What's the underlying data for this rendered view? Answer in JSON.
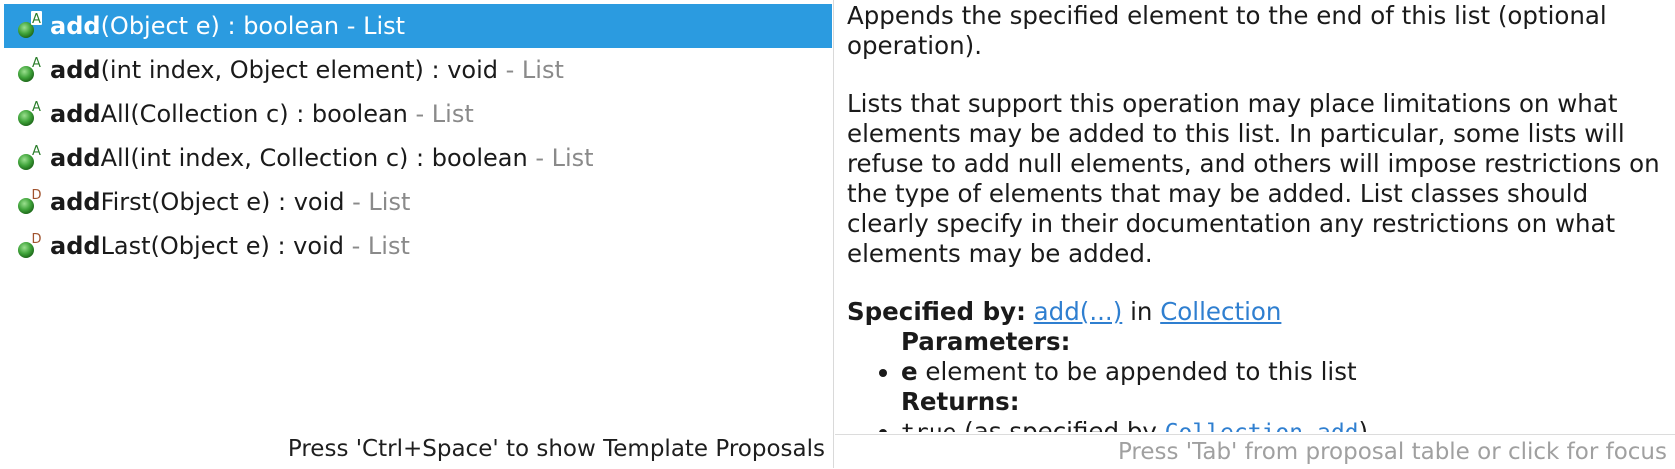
{
  "proposals": [
    {
      "prefix": "add",
      "rest": "(Object e) : boolean",
      "qualifier": " - List",
      "icon": "abstract-method-icon",
      "badge": "A",
      "selected": true
    },
    {
      "prefix": "add",
      "rest": "(int index, Object element) : void",
      "qualifier": " - List",
      "icon": "abstract-method-icon",
      "badge": "A",
      "selected": false
    },
    {
      "prefix": "add",
      "rest": "All(Collection c) : boolean",
      "qualifier": " - List",
      "icon": "abstract-method-icon",
      "badge": "A",
      "selected": false
    },
    {
      "prefix": "add",
      "rest": "All(int index, Collection c) : boolean",
      "qualifier": " - List",
      "icon": "abstract-method-icon",
      "badge": "A",
      "selected": false
    },
    {
      "prefix": "add",
      "rest": "First(Object e) : void",
      "qualifier": " - List",
      "icon": "default-method-icon",
      "badge": "D",
      "selected": false
    },
    {
      "prefix": "add",
      "rest": "Last(Object e) : void",
      "qualifier": " - List",
      "icon": "default-method-icon",
      "badge": "D",
      "selected": false
    }
  ],
  "proposal_status": "Press 'Ctrl+Space' to show Template Proposals",
  "doc": {
    "para1": "Appends the specified element to the end of this list (optional operation).",
    "para2": "Lists that support this operation may place limitations on what elements may be added to this list. In particular, some lists will refuse to add null elements, and others will impose restrictions on the type of elements that may be added. List classes should clearly specify in their documentation any restrictions on what elements may be added.",
    "specified_by_label": "Specified by:",
    "specified_by_method": "add(...)",
    "specified_by_in": " in ",
    "specified_by_class": "Collection",
    "params_label": "Parameters:",
    "param_name": "e",
    "param_desc": " element to be appended to this list",
    "returns_label": "Returns:",
    "returns_code": "true",
    "returns_text": " (as specified by ",
    "returns_link": "Collection.add",
    "returns_close": ")",
    "status": "Press 'Tab' from proposal table or click for focus"
  },
  "colors": {
    "selection": "#2b9be0",
    "method_green": "#3fa33a",
    "badge_abstract": "#2a7d2a",
    "badge_default": "#a0522d",
    "link": "#2f7fd0",
    "qualifier": "#8a8a8a"
  }
}
